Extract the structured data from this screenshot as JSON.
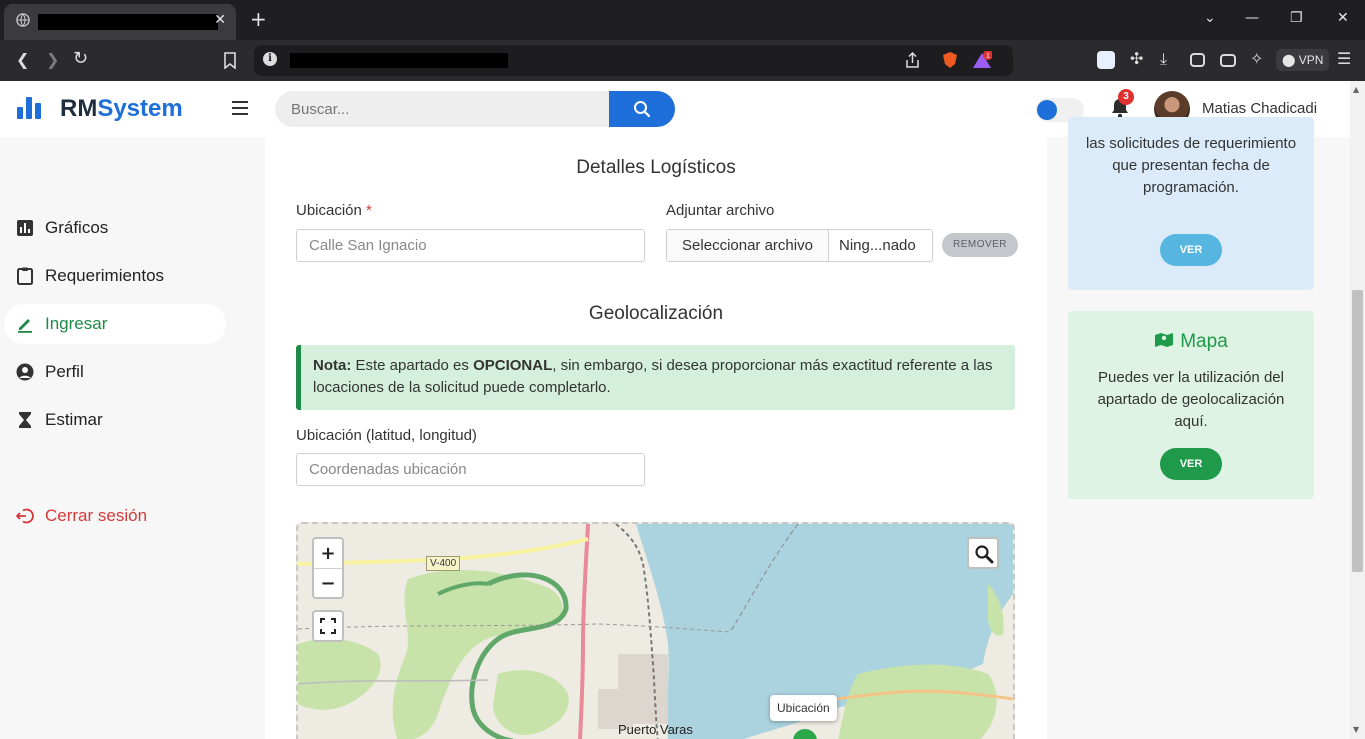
{
  "browser": {
    "tab_close": "✕",
    "new_tab": "+",
    "vpn_label": "VPN",
    "brave_badge_count": "1"
  },
  "app": {
    "logo_prefix": "RM",
    "logo_suffix": "System",
    "search_placeholder": "Buscar...",
    "notifications_count": "3",
    "user_name": "Matias Chadicadi"
  },
  "sidebar": {
    "items": [
      {
        "label": "Gráficos",
        "icon": "chart-icon"
      },
      {
        "label": "Requerimientos",
        "icon": "clipboard-icon"
      },
      {
        "label": "Ingresar",
        "icon": "pencil-icon",
        "active": true
      },
      {
        "label": "Perfil",
        "icon": "user-icon"
      },
      {
        "label": "Estimar",
        "icon": "hourglass-icon"
      }
    ],
    "logout_label": "Cerrar sesión"
  },
  "form": {
    "logistics_title": "Detalles Logísticos",
    "location_label": "Ubicación",
    "required_mark": "*",
    "location_value": "Calle San Ignacio",
    "attach_label": "Adjuntar archivo",
    "file_button": "Seleccionar archivo",
    "file_name": "Ning...nado",
    "remove_button": "REMOVER",
    "geo_title": "Geolocalización",
    "note_prefix": "Nota:",
    "note_mid": " Este apartado es ",
    "note_bold": "OPCIONAL",
    "note_rest": ", sin embargo, si desea proporcionar más exactitud referente a las locaciones de la solicitud puede completarlo.",
    "coords_label": "Ubicación (latitud, longitud)",
    "coords_placeholder": "Coordenadas ubicación"
  },
  "map": {
    "zoom_in": "+",
    "zoom_out": "−",
    "road_label": "V-400",
    "town_label": "Puerto Varas",
    "marker_tooltip": "Ubicación"
  },
  "right_panel": {
    "info_text": "las solicitudes de requerimiento que presentan fecha de programación.",
    "info_button": "VER",
    "map_card_title": "Mapa",
    "map_card_text": "Puedes ver la utilización del apartado de geolocalización aquí.",
    "map_card_button": "VER"
  },
  "colors": {
    "primary": "#1e6fd9",
    "success": "#1f8a47",
    "danger": "#d33b3b"
  }
}
